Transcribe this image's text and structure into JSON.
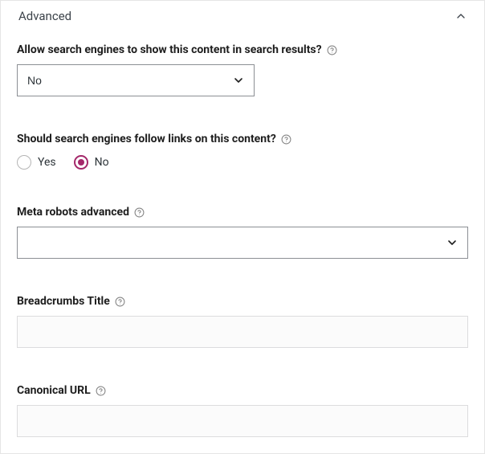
{
  "panel": {
    "title": "Advanced",
    "expanded": true
  },
  "fields": {
    "allow_search": {
      "label": "Allow search engines to show this content in search results?",
      "value": "No"
    },
    "follow_links": {
      "label": "Should search engines follow links on this content?",
      "options": {
        "yes": "Yes",
        "no": "No"
      },
      "selected": "no"
    },
    "meta_robots": {
      "label": "Meta robots advanced",
      "value": ""
    },
    "breadcrumbs": {
      "label": "Breadcrumbs Title",
      "value": ""
    },
    "canonical": {
      "label": "Canonical URL",
      "value": ""
    }
  }
}
